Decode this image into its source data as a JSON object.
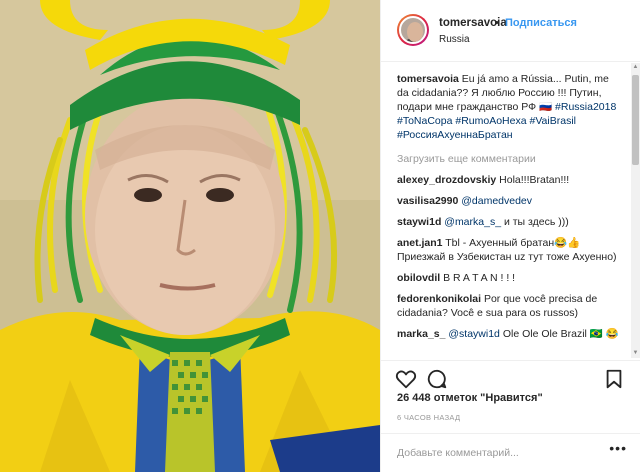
{
  "post": {
    "username": "tomersavoia",
    "separator": "•",
    "follow_label": "Подписаться",
    "location": "Russia"
  },
  "caption": {
    "user": "tomersavoia",
    "text": "Eu já amo a Rússia... Putin, me da cidadania?? Я люблю Россию !!! Путин, подари мне гражданство РФ 🇷🇺",
    "tags": "#Russia2018 #ToNaCopa #RumoAoHexa #VaiBrasil #РоссияАхуеннаБратан"
  },
  "load_more_label": "Загрузить еще комментарии",
  "comments": [
    {
      "user": "alexey_drozdovskiy",
      "mention": "",
      "text": "Hola!!!Bratan!!!"
    },
    {
      "user": "vasilisa2990",
      "mention": "@damedvedev",
      "text": ""
    },
    {
      "user": "staywi1d",
      "mention": "@marka_s_",
      "text": "и ты здесь )))"
    },
    {
      "user": "anet.jan1",
      "mention": "",
      "text": "Tbl - Ахуенный братан😂👍 Приезжай в Узбекистан uz тут тоже Ахуенно)"
    },
    {
      "user": "obilovdil",
      "mention": "",
      "text": "B R A T A N ! ! !"
    },
    {
      "user": "fedorenkonikolai",
      "mention": "",
      "text": "Por que você precisa de cidadania? Você e sua para os russos)"
    },
    {
      "user": "marka_s_",
      "mention": "@staywi1d",
      "text": "Ole Ole Ole Brazil 🇧🇷 😂"
    }
  ],
  "likes_label": "26 448 отметок \"Нравится\"",
  "time_label": "6 ЧАСОВ НАЗАД",
  "add_comment_placeholder": "Добавьте комментарий...",
  "more_options": "•••",
  "icons": {
    "like": "heart-icon",
    "comment": "comment-icon",
    "save": "bookmark-icon"
  },
  "colors": {
    "link": "#3897f0",
    "hashtag": "#003569",
    "muted": "#999999",
    "brazil_yellow": "#f5d90a",
    "brazil_green": "#1f8a3a"
  }
}
